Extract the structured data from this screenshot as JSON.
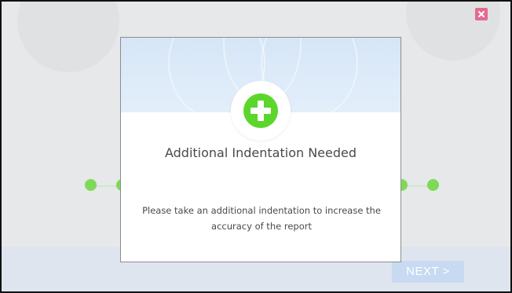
{
  "dialog": {
    "title": "Additional Indentation Needed",
    "message": "Please take an additional indentation to increase the accuracy of the report",
    "icon": "plus-circle-icon",
    "icon_color": "#5cd62c"
  },
  "window": {
    "close_icon": "close-icon",
    "close_color": "#e46a8e"
  },
  "footer": {
    "next_label": "NEXT >"
  },
  "progress": {
    "dot_color": "#7ed957"
  }
}
